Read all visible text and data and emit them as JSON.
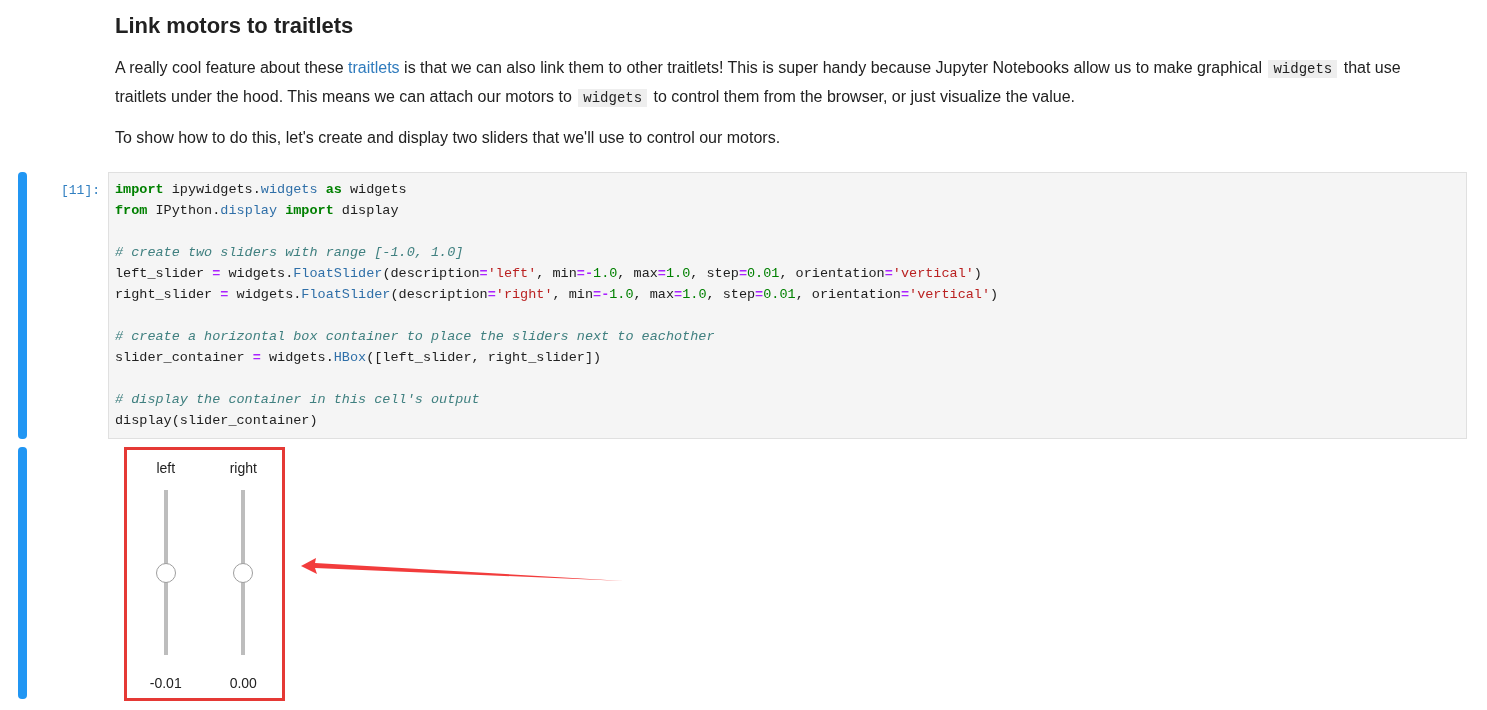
{
  "heading": "Link motors to traitlets",
  "paragraphs": [
    [
      {
        "kind": "text",
        "text": "A really cool feature about these "
      },
      {
        "kind": "link",
        "text": "traitlets"
      },
      {
        "kind": "text",
        "text": " is that we can also link them to other traitlets! This is super handy because Jupyter Notebooks allow us to make graphical "
      },
      {
        "kind": "code",
        "text": "widgets"
      },
      {
        "kind": "text",
        "text": " that use traitlets under the hood. This means we can attach our motors to "
      },
      {
        "kind": "code",
        "text": "widgets"
      },
      {
        "kind": "text",
        "text": " to control them from the browser, or just visualize the value."
      }
    ],
    [
      {
        "kind": "text",
        "text": "To show how to do this, let's create and display two sliders that we'll use to control our motors."
      }
    ]
  ],
  "cell": {
    "prompt": "[11]:",
    "blocks": [
      [
        [
          {
            "kind": "kw",
            "text": "import"
          },
          {
            "kind": "plain",
            "text": " ipywidgets."
          },
          {
            "kind": "attr",
            "text": "widgets"
          },
          {
            "kind": "kw",
            "text": " as"
          },
          {
            "kind": "plain",
            "text": " widgets"
          }
        ],
        [
          {
            "kind": "kw",
            "text": "from"
          },
          {
            "kind": "plain",
            "text": " IPython."
          },
          {
            "kind": "attr",
            "text": "display"
          },
          {
            "kind": "kw",
            "text": " import"
          },
          {
            "kind": "plain",
            "text": " display"
          }
        ]
      ],
      [
        [
          {
            "kind": "comment",
            "text": "# create two sliders with range [-1.0, 1.0]"
          }
        ],
        [
          {
            "kind": "plain",
            "text": "left_slider "
          },
          {
            "kind": "op",
            "text": "="
          },
          {
            "kind": "plain",
            "text": " widgets."
          },
          {
            "kind": "attr",
            "text": "FloatSlider"
          },
          {
            "kind": "plain",
            "text": "(description"
          },
          {
            "kind": "op",
            "text": "="
          },
          {
            "kind": "str",
            "text": "'left'"
          },
          {
            "kind": "plain",
            "text": ", min"
          },
          {
            "kind": "op",
            "text": "=-"
          },
          {
            "kind": "num",
            "text": "1.0"
          },
          {
            "kind": "plain",
            "text": ", max"
          },
          {
            "kind": "op",
            "text": "="
          },
          {
            "kind": "num",
            "text": "1.0"
          },
          {
            "kind": "plain",
            "text": ", step"
          },
          {
            "kind": "op",
            "text": "="
          },
          {
            "kind": "num",
            "text": "0.01"
          },
          {
            "kind": "plain",
            "text": ", orientation"
          },
          {
            "kind": "op",
            "text": "="
          },
          {
            "kind": "str",
            "text": "'vertical'"
          },
          {
            "kind": "plain",
            "text": ")"
          }
        ],
        [
          {
            "kind": "plain",
            "text": "right_slider "
          },
          {
            "kind": "op",
            "text": "="
          },
          {
            "kind": "plain",
            "text": " widgets."
          },
          {
            "kind": "attr",
            "text": "FloatSlider"
          },
          {
            "kind": "plain",
            "text": "(description"
          },
          {
            "kind": "op",
            "text": "="
          },
          {
            "kind": "str",
            "text": "'right'"
          },
          {
            "kind": "plain",
            "text": ", min"
          },
          {
            "kind": "op",
            "text": "=-"
          },
          {
            "kind": "num",
            "text": "1.0"
          },
          {
            "kind": "plain",
            "text": ", max"
          },
          {
            "kind": "op",
            "text": "="
          },
          {
            "kind": "num",
            "text": "1.0"
          },
          {
            "kind": "plain",
            "text": ", step"
          },
          {
            "kind": "op",
            "text": "="
          },
          {
            "kind": "num",
            "text": "0.01"
          },
          {
            "kind": "plain",
            "text": ", orientation"
          },
          {
            "kind": "op",
            "text": "="
          },
          {
            "kind": "str",
            "text": "'vertical'"
          },
          {
            "kind": "plain",
            "text": ")"
          }
        ]
      ],
      [
        [
          {
            "kind": "comment",
            "text": "# create a horizontal box container to place the sliders next to eachother"
          }
        ],
        [
          {
            "kind": "plain",
            "text": "slider_container "
          },
          {
            "kind": "op",
            "text": "="
          },
          {
            "kind": "plain",
            "text": " widgets."
          },
          {
            "kind": "attr",
            "text": "HBox"
          },
          {
            "kind": "plain",
            "text": "([left_slider, right_slider])"
          }
        ]
      ],
      [
        [
          {
            "kind": "comment",
            "text": "# display the container in this cell's output"
          }
        ],
        [
          {
            "kind": "plain",
            "text": "display(slider_container)"
          }
        ]
      ]
    ]
  },
  "sliders": [
    {
      "label": "left",
      "level": 0.495,
      "reading": "-0.01"
    },
    {
      "label": "right",
      "level": 0.5,
      "reading": "0.00"
    }
  ]
}
